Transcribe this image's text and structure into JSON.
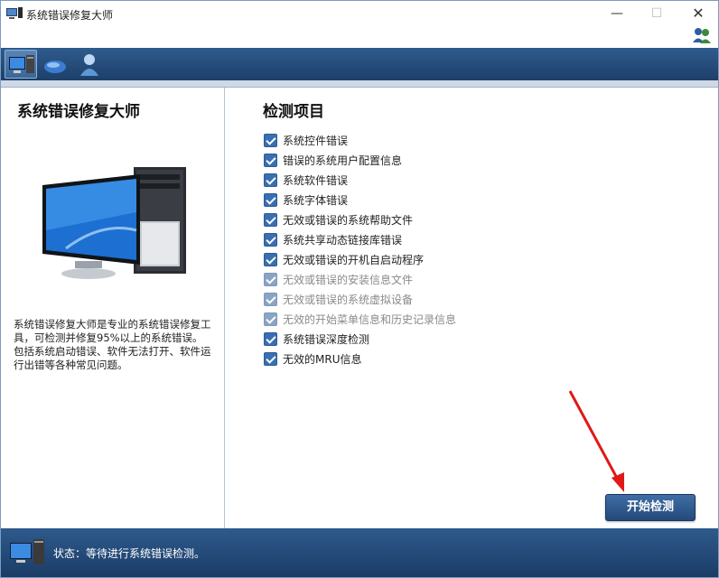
{
  "window": {
    "title": "系统错误修复大师",
    "minimize": "—",
    "maximize": "☐",
    "close": "✕"
  },
  "toolbar": {
    "tools": [
      {
        "name": "computer-repair-tool",
        "icon": "monitor-icon",
        "active": true
      },
      {
        "name": "mouse-tool",
        "icon": "mouse-icon",
        "active": false
      },
      {
        "name": "user-tool",
        "icon": "user-icon",
        "active": false
      }
    ]
  },
  "left_panel": {
    "title": "系统错误修复大师",
    "image": "desktop-computer-icon",
    "description_1": "系统错误修复大师是专业的系统错误修复工具，可检测并修复95%以上的系统错误。",
    "description_2": "包括系统启动错误、软件无法打开、软件运行出错等各种常见问题。"
  },
  "right_panel": {
    "title": "检测项目",
    "items": [
      {
        "label": "系统控件错误",
        "checked": true,
        "enabled": true
      },
      {
        "label": "错误的系统用户配置信息",
        "checked": true,
        "enabled": true
      },
      {
        "label": "系统软件错误",
        "checked": true,
        "enabled": true
      },
      {
        "label": "系统字体错误",
        "checked": true,
        "enabled": true
      },
      {
        "label": "无效或错误的系统帮助文件",
        "checked": true,
        "enabled": true
      },
      {
        "label": "系统共享动态链接库错误",
        "checked": true,
        "enabled": true
      },
      {
        "label": "无效或错误的开机自启动程序",
        "checked": true,
        "enabled": true
      },
      {
        "label": "无效或错误的安装信息文件",
        "checked": true,
        "enabled": false
      },
      {
        "label": "无效或错误的系统虚拟设备",
        "checked": true,
        "enabled": false
      },
      {
        "label": "无效的开始菜单信息和历史记录信息",
        "checked": true,
        "enabled": false
      },
      {
        "label": "系统错误深度检测",
        "checked": true,
        "enabled": true
      },
      {
        "label": "无效的MRU信息",
        "checked": true,
        "enabled": true
      }
    ],
    "start_button": "开始检测"
  },
  "status": {
    "label": "状态：",
    "value": "等待进行系统错误检测。"
  },
  "colors": {
    "toolbar_bg": "#2f5b8d",
    "status_bg": "#2e5a8c",
    "checkbox": "#3a6fb0",
    "arrow": "#e01818"
  }
}
